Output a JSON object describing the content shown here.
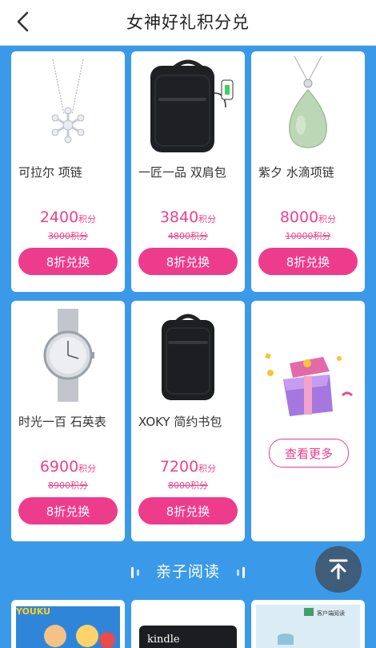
{
  "header": {
    "title": "女神好礼积分兑"
  },
  "products": [
    {
      "name": "可拉尔 项链",
      "price": "2400",
      "unit": "积分",
      "original": "3000积分",
      "button": "8折兑换",
      "image": "snowflake-necklace"
    },
    {
      "name": "一匠一品 双肩包",
      "price": "3840",
      "unit": "积分",
      "original": "4800积分",
      "button": "8折兑换",
      "image": "black-backpack"
    },
    {
      "name": "紫夕 水滴项链",
      "price": "8000",
      "unit": "积分",
      "original": "10000积分",
      "button": "8折兑换",
      "image": "jade-pendant"
    },
    {
      "name": "时光一百 石英表",
      "price": "6900",
      "unit": "积分",
      "original": "8900积分",
      "button": "8折兑换",
      "image": "silver-watch"
    },
    {
      "name": "XOKY 简约书包",
      "price": "7200",
      "unit": "积分",
      "original": "8000积分",
      "button": "8折兑换",
      "image": "black-schoolbag"
    }
  ],
  "more": {
    "label": "查看更多",
    "image": "gift-box"
  },
  "section": {
    "title": "亲子阅读"
  },
  "bottom_cards": [
    {
      "image": "youku-kids-cover",
      "text": "YOUKU"
    },
    {
      "image": "kindle-device",
      "text": "kindle"
    },
    {
      "image": "ebook-card",
      "text": "客户端阅读"
    }
  ],
  "colors": {
    "background": "#3a9ae9",
    "accent": "#ee3c8c",
    "price": "#f0418a",
    "scroll_button": "#3f5c78"
  }
}
